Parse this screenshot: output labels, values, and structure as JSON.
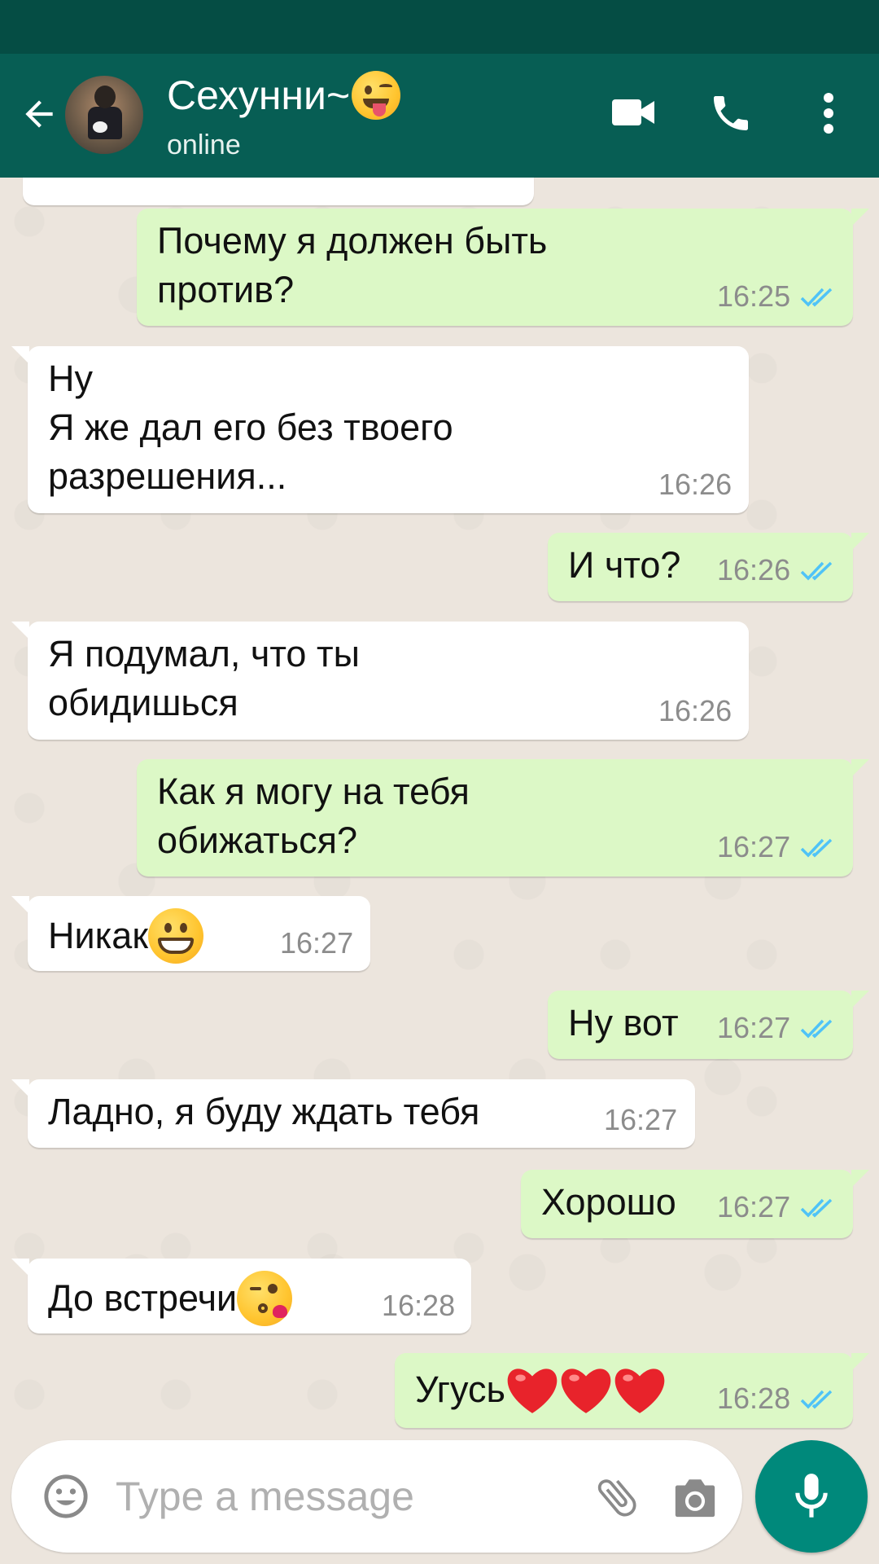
{
  "header": {
    "contact_name": "Сехунни~",
    "status": "online",
    "name_emoji": "winking-face-with-tongue-emoji",
    "icons": [
      "back-arrow-icon",
      "video-call-icon",
      "phone-icon",
      "more-options-icon"
    ]
  },
  "colors": {
    "app_bar": "#075e54",
    "status_bar": "#054d44",
    "chat_background": "#ece5dd",
    "incoming_bubble": "#ffffff",
    "outgoing_bubble": "#dcf8c6",
    "read_ticks": "#4fc3f7",
    "mic_button": "#00897b"
  },
  "messages": [
    {
      "direction": "out",
      "lines": [
        "Почему я должен быть",
        "против?"
      ],
      "time": "16:25",
      "read": true
    },
    {
      "direction": "in",
      "lines": [
        "Ну",
        "Я же дал его без твоего",
        "разрешения..."
      ],
      "time": "16:26"
    },
    {
      "direction": "out",
      "lines": [
        "И что?"
      ],
      "time": "16:26",
      "read": true
    },
    {
      "direction": "in",
      "lines": [
        "Я подумал, что ты",
        "обидишься"
      ],
      "time": "16:26"
    },
    {
      "direction": "out",
      "lines": [
        "Как я могу на тебя",
        "обижаться?"
      ],
      "time": "16:27",
      "read": true
    },
    {
      "direction": "in",
      "lines": [
        "Никак"
      ],
      "emoji": "grinning-face-emoji",
      "time": "16:27"
    },
    {
      "direction": "out",
      "lines": [
        "Ну вот"
      ],
      "time": "16:27",
      "read": true
    },
    {
      "direction": "in",
      "lines": [
        "Ладно, я буду ждать тебя"
      ],
      "time": "16:27"
    },
    {
      "direction": "out",
      "lines": [
        "Хорошо"
      ],
      "time": "16:27",
      "read": true
    },
    {
      "direction": "in",
      "lines": [
        "До встречи"
      ],
      "emoji": "face-blowing-kiss-emoji",
      "time": "16:28"
    },
    {
      "direction": "out",
      "lines": [
        "Угусь"
      ],
      "emoji": "red-heart-emoji x3",
      "time": "16:28",
      "read": true
    }
  ],
  "composer": {
    "placeholder": "Type a message",
    "icons": [
      "emoji-icon",
      "attach-icon",
      "camera-icon",
      "mic-icon"
    ]
  }
}
